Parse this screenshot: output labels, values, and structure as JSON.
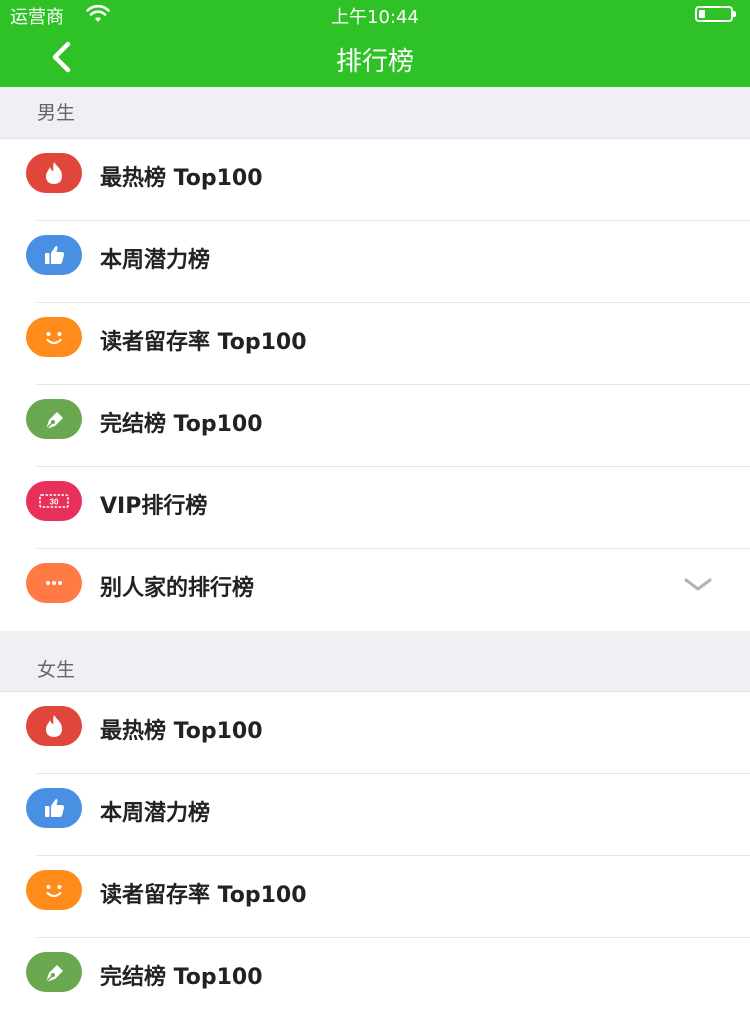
{
  "status_bar": {
    "carrier": "运营商",
    "time": "上午10:44",
    "battery_level": 0.2
  },
  "nav": {
    "title": "排行榜"
  },
  "colors": {
    "header_green": "#2ec227",
    "hot_red": "#e0473a",
    "like_blue": "#4a90e2",
    "smile_orange": "#ff8c1a",
    "pen_green": "#6aa84f",
    "vip_pink": "#e8315a",
    "more_orange": "#ff7a45"
  },
  "sections": [
    {
      "title": "男生",
      "items": [
        {
          "label": "最热榜 Top100",
          "icon": "flame-icon"
        },
        {
          "label": "本周潜力榜",
          "icon": "thumbs-up-icon"
        },
        {
          "label": "读者留存率 Top100",
          "icon": "smile-icon"
        },
        {
          "label": "完结榜 Top100",
          "icon": "pen-icon"
        },
        {
          "label": "VIP排行榜",
          "icon": "vip-ticket-icon",
          "icon_text": "30"
        },
        {
          "label": "别人家的排行榜",
          "icon": "more-dots-icon",
          "expandable": true
        }
      ]
    },
    {
      "title": "女生",
      "items": [
        {
          "label": "最热榜 Top100",
          "icon": "flame-icon"
        },
        {
          "label": "本周潜力榜",
          "icon": "thumbs-up-icon"
        },
        {
          "label": "读者留存率 Top100",
          "icon": "smile-icon"
        },
        {
          "label": "完结榜 Top100",
          "icon": "pen-icon"
        }
      ]
    }
  ]
}
